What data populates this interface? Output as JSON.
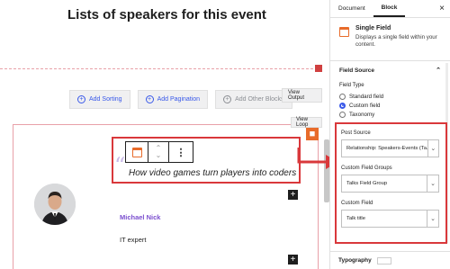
{
  "editor": {
    "page_title": "Lists of speakers for this event",
    "buttons": {
      "add_sorting": "Add Sorting",
      "add_pagination": "Add Pagination",
      "add_other_blocks": "Add Other Blocks",
      "view_output": "View Output",
      "view_loop": "View Loop"
    },
    "item": {
      "talk_title": "How video games turn players into coders",
      "speaker_name": "Michael Nick",
      "speaker_role": "IT expert"
    }
  },
  "sidebar": {
    "tabs": [
      "Document",
      "Block"
    ],
    "active_tab": "Block",
    "block": {
      "name": "Single Field",
      "description": "Displays a single field within your content."
    },
    "field_source": {
      "heading": "Field Source",
      "field_type_label": "Field Type",
      "options": [
        "Standard field",
        "Custom field",
        "Taxonomy"
      ],
      "selected": "Custom field"
    },
    "post_source": {
      "label": "Post Source",
      "value": "Relationship: Speakers-Events (Ta..."
    },
    "custom_field_groups": {
      "label": "Custom Field Groups",
      "value": "Talks Field Group"
    },
    "custom_field": {
      "label": "Custom Field",
      "value": "Talk title"
    },
    "typography": {
      "heading": "Typography"
    }
  },
  "colors": {
    "accent": "#3858e9",
    "highlight": "#d9383b",
    "brand_orange": "#e86b2a",
    "name_purple": "#7b4fcf"
  }
}
